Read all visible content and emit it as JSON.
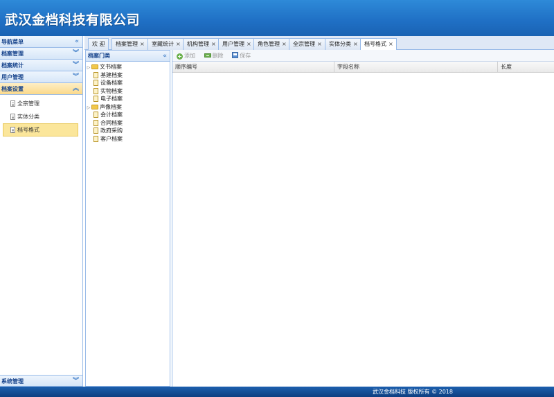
{
  "app": {
    "title": "武汉金档科技有限公司"
  },
  "sidebar": {
    "header": "导航菜单",
    "sections": [
      {
        "label": "档案管理"
      },
      {
        "label": "档案统计"
      },
      {
        "label": "用户管理"
      },
      {
        "label": "档案设置",
        "items": [
          "全宗管理",
          "实体分类",
          "档号格式"
        ]
      }
    ],
    "bottom": "系统管理"
  },
  "tabs": [
    "欢 迎",
    "档案管理",
    "室藏统计",
    "机构管理",
    "用户管理",
    "角色管理",
    "全宗管理",
    "实体分类",
    "档号格式"
  ],
  "tree": {
    "title": "档案门类",
    "nodes": [
      {
        "label": "文书档案",
        "type": "folder"
      },
      {
        "label": "基建档案",
        "type": "leaf"
      },
      {
        "label": "设备档案",
        "type": "leaf"
      },
      {
        "label": "实物档案",
        "type": "leaf"
      },
      {
        "label": "电子档案",
        "type": "leaf"
      },
      {
        "label": "声像档案",
        "type": "folder"
      },
      {
        "label": "会计档案",
        "type": "leaf"
      },
      {
        "label": "合同档案",
        "type": "leaf"
      },
      {
        "label": "政府采购",
        "type": "leaf"
      },
      {
        "label": "客户档案",
        "type": "leaf"
      }
    ]
  },
  "toolbar": {
    "add": "添加",
    "delete": "删除",
    "save": "保存"
  },
  "grid": {
    "columns": [
      "顺序编号",
      "字段名称",
      "长度"
    ]
  },
  "footer": {
    "copyright": "武汉金档科技 版权所有 © 2018"
  },
  "colors": {
    "header_blue": "#1f6fc4",
    "active_yellow": "#fbe69b",
    "border_blue": "#99bbe8"
  }
}
